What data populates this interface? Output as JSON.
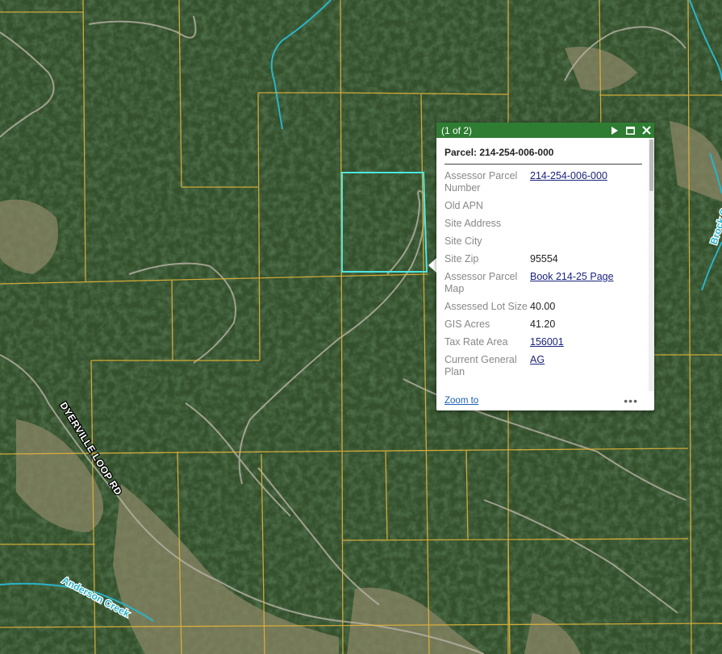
{
  "map": {
    "road_label": "DYERVILLE LOOP RD",
    "creek_labels": [
      "Anderson Creek",
      "Brock Creek"
    ],
    "colors": {
      "forest": "#2f4a2a",
      "parcel_line": "#e0b23a",
      "selected_parcel": "#4ee6e0",
      "water": "#2bb3c8",
      "road": "#b9b3a6",
      "clearing": "#8a8666"
    }
  },
  "popup": {
    "count": "(1 of 2)",
    "title": "Parcel: 214-254-006-000",
    "header_color": "#2e7d32",
    "attributes": [
      {
        "label": "Assessor Parcel Number",
        "value": "214-254-006-000",
        "link": true
      },
      {
        "label": "Old APN",
        "value": "",
        "link": false
      },
      {
        "label": "Site Address",
        "value": "",
        "link": false
      },
      {
        "label": "Site City",
        "value": "",
        "link": false
      },
      {
        "label": "Site Zip",
        "value": "95554",
        "link": false
      },
      {
        "label": "Assessor Parcel Map",
        "value": "Book 214-25 Page",
        "link": true
      },
      {
        "label": "Assessed Lot Size",
        "value": "40.00",
        "link": false
      },
      {
        "label": "GIS Acres",
        "value": "41.20",
        "link": false
      },
      {
        "label": "Tax Rate Area",
        "value": "156001",
        "link": true
      },
      {
        "label": "Current General Plan",
        "value": "AG",
        "link": true
      }
    ],
    "zoom_label": "Zoom to",
    "more_label": "•••",
    "icons": {
      "next": "play-icon",
      "maximize": "maximize-icon",
      "close": "close-icon"
    }
  }
}
